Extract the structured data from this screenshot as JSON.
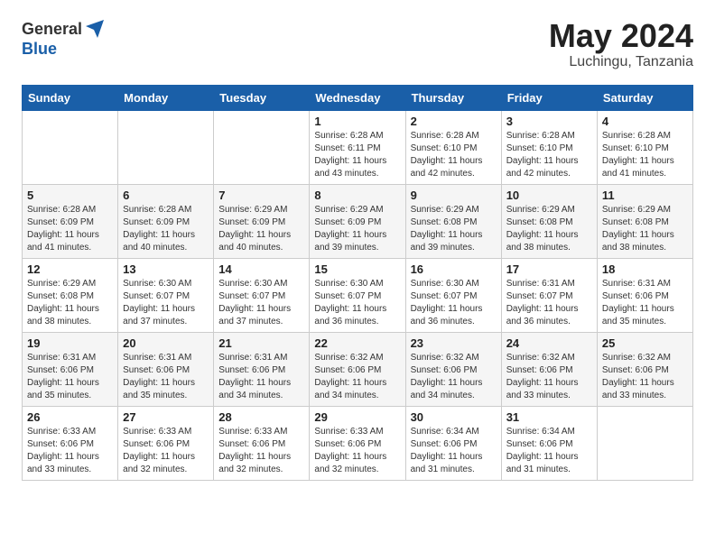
{
  "header": {
    "logo_general": "General",
    "logo_blue": "Blue",
    "month": "May 2024",
    "location": "Luchingu, Tanzania"
  },
  "days_of_week": [
    "Sunday",
    "Monday",
    "Tuesday",
    "Wednesday",
    "Thursday",
    "Friday",
    "Saturday"
  ],
  "weeks": [
    [
      {
        "day": "",
        "info": ""
      },
      {
        "day": "",
        "info": ""
      },
      {
        "day": "",
        "info": ""
      },
      {
        "day": "1",
        "info": "Sunrise: 6:28 AM\nSunset: 6:11 PM\nDaylight: 11 hours\nand 43 minutes."
      },
      {
        "day": "2",
        "info": "Sunrise: 6:28 AM\nSunset: 6:10 PM\nDaylight: 11 hours\nand 42 minutes."
      },
      {
        "day": "3",
        "info": "Sunrise: 6:28 AM\nSunset: 6:10 PM\nDaylight: 11 hours\nand 42 minutes."
      },
      {
        "day": "4",
        "info": "Sunrise: 6:28 AM\nSunset: 6:10 PM\nDaylight: 11 hours\nand 41 minutes."
      }
    ],
    [
      {
        "day": "5",
        "info": "Sunrise: 6:28 AM\nSunset: 6:09 PM\nDaylight: 11 hours\nand 41 minutes."
      },
      {
        "day": "6",
        "info": "Sunrise: 6:28 AM\nSunset: 6:09 PM\nDaylight: 11 hours\nand 40 minutes."
      },
      {
        "day": "7",
        "info": "Sunrise: 6:29 AM\nSunset: 6:09 PM\nDaylight: 11 hours\nand 40 minutes."
      },
      {
        "day": "8",
        "info": "Sunrise: 6:29 AM\nSunset: 6:09 PM\nDaylight: 11 hours\nand 39 minutes."
      },
      {
        "day": "9",
        "info": "Sunrise: 6:29 AM\nSunset: 6:08 PM\nDaylight: 11 hours\nand 39 minutes."
      },
      {
        "day": "10",
        "info": "Sunrise: 6:29 AM\nSunset: 6:08 PM\nDaylight: 11 hours\nand 38 minutes."
      },
      {
        "day": "11",
        "info": "Sunrise: 6:29 AM\nSunset: 6:08 PM\nDaylight: 11 hours\nand 38 minutes."
      }
    ],
    [
      {
        "day": "12",
        "info": "Sunrise: 6:29 AM\nSunset: 6:08 PM\nDaylight: 11 hours\nand 38 minutes."
      },
      {
        "day": "13",
        "info": "Sunrise: 6:30 AM\nSunset: 6:07 PM\nDaylight: 11 hours\nand 37 minutes."
      },
      {
        "day": "14",
        "info": "Sunrise: 6:30 AM\nSunset: 6:07 PM\nDaylight: 11 hours\nand 37 minutes."
      },
      {
        "day": "15",
        "info": "Sunrise: 6:30 AM\nSunset: 6:07 PM\nDaylight: 11 hours\nand 36 minutes."
      },
      {
        "day": "16",
        "info": "Sunrise: 6:30 AM\nSunset: 6:07 PM\nDaylight: 11 hours\nand 36 minutes."
      },
      {
        "day": "17",
        "info": "Sunrise: 6:31 AM\nSunset: 6:07 PM\nDaylight: 11 hours\nand 36 minutes."
      },
      {
        "day": "18",
        "info": "Sunrise: 6:31 AM\nSunset: 6:06 PM\nDaylight: 11 hours\nand 35 minutes."
      }
    ],
    [
      {
        "day": "19",
        "info": "Sunrise: 6:31 AM\nSunset: 6:06 PM\nDaylight: 11 hours\nand 35 minutes."
      },
      {
        "day": "20",
        "info": "Sunrise: 6:31 AM\nSunset: 6:06 PM\nDaylight: 11 hours\nand 35 minutes."
      },
      {
        "day": "21",
        "info": "Sunrise: 6:31 AM\nSunset: 6:06 PM\nDaylight: 11 hours\nand 34 minutes."
      },
      {
        "day": "22",
        "info": "Sunrise: 6:32 AM\nSunset: 6:06 PM\nDaylight: 11 hours\nand 34 minutes."
      },
      {
        "day": "23",
        "info": "Sunrise: 6:32 AM\nSunset: 6:06 PM\nDaylight: 11 hours\nand 34 minutes."
      },
      {
        "day": "24",
        "info": "Sunrise: 6:32 AM\nSunset: 6:06 PM\nDaylight: 11 hours\nand 33 minutes."
      },
      {
        "day": "25",
        "info": "Sunrise: 6:32 AM\nSunset: 6:06 PM\nDaylight: 11 hours\nand 33 minutes."
      }
    ],
    [
      {
        "day": "26",
        "info": "Sunrise: 6:33 AM\nSunset: 6:06 PM\nDaylight: 11 hours\nand 33 minutes."
      },
      {
        "day": "27",
        "info": "Sunrise: 6:33 AM\nSunset: 6:06 PM\nDaylight: 11 hours\nand 32 minutes."
      },
      {
        "day": "28",
        "info": "Sunrise: 6:33 AM\nSunset: 6:06 PM\nDaylight: 11 hours\nand 32 minutes."
      },
      {
        "day": "29",
        "info": "Sunrise: 6:33 AM\nSunset: 6:06 PM\nDaylight: 11 hours\nand 32 minutes."
      },
      {
        "day": "30",
        "info": "Sunrise: 6:34 AM\nSunset: 6:06 PM\nDaylight: 11 hours\nand 31 minutes."
      },
      {
        "day": "31",
        "info": "Sunrise: 6:34 AM\nSunset: 6:06 PM\nDaylight: 11 hours\nand 31 minutes."
      },
      {
        "day": "",
        "info": ""
      }
    ]
  ]
}
